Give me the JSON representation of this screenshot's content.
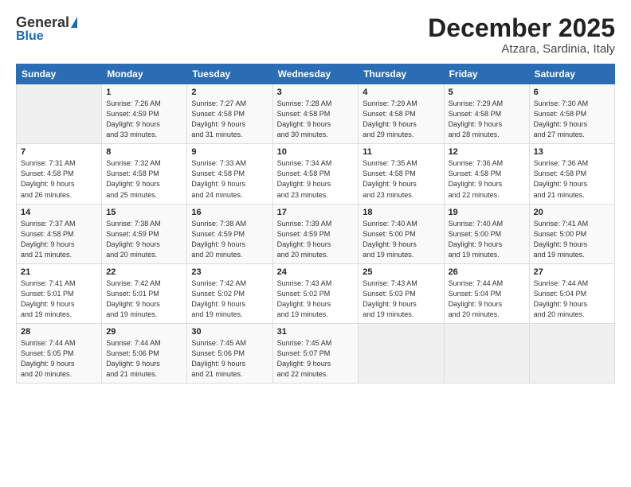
{
  "header": {
    "logo_general": "General",
    "logo_blue": "Blue",
    "month_title": "December 2025",
    "location": "Atzara, Sardinia, Italy"
  },
  "days_of_week": [
    "Sunday",
    "Monday",
    "Tuesday",
    "Wednesday",
    "Thursday",
    "Friday",
    "Saturday"
  ],
  "weeks": [
    [
      {
        "num": "",
        "info": ""
      },
      {
        "num": "1",
        "info": "Sunrise: 7:26 AM\nSunset: 4:59 PM\nDaylight: 9 hours\nand 33 minutes."
      },
      {
        "num": "2",
        "info": "Sunrise: 7:27 AM\nSunset: 4:58 PM\nDaylight: 9 hours\nand 31 minutes."
      },
      {
        "num": "3",
        "info": "Sunrise: 7:28 AM\nSunset: 4:58 PM\nDaylight: 9 hours\nand 30 minutes."
      },
      {
        "num": "4",
        "info": "Sunrise: 7:29 AM\nSunset: 4:58 PM\nDaylight: 9 hours\nand 29 minutes."
      },
      {
        "num": "5",
        "info": "Sunrise: 7:29 AM\nSunset: 4:58 PM\nDaylight: 9 hours\nand 28 minutes."
      },
      {
        "num": "6",
        "info": "Sunrise: 7:30 AM\nSunset: 4:58 PM\nDaylight: 9 hours\nand 27 minutes."
      }
    ],
    [
      {
        "num": "7",
        "info": "Sunrise: 7:31 AM\nSunset: 4:58 PM\nDaylight: 9 hours\nand 26 minutes."
      },
      {
        "num": "8",
        "info": "Sunrise: 7:32 AM\nSunset: 4:58 PM\nDaylight: 9 hours\nand 25 minutes."
      },
      {
        "num": "9",
        "info": "Sunrise: 7:33 AM\nSunset: 4:58 PM\nDaylight: 9 hours\nand 24 minutes."
      },
      {
        "num": "10",
        "info": "Sunrise: 7:34 AM\nSunset: 4:58 PM\nDaylight: 9 hours\nand 23 minutes."
      },
      {
        "num": "11",
        "info": "Sunrise: 7:35 AM\nSunset: 4:58 PM\nDaylight: 9 hours\nand 23 minutes."
      },
      {
        "num": "12",
        "info": "Sunrise: 7:36 AM\nSunset: 4:58 PM\nDaylight: 9 hours\nand 22 minutes."
      },
      {
        "num": "13",
        "info": "Sunrise: 7:36 AM\nSunset: 4:58 PM\nDaylight: 9 hours\nand 21 minutes."
      }
    ],
    [
      {
        "num": "14",
        "info": "Sunrise: 7:37 AM\nSunset: 4:58 PM\nDaylight: 9 hours\nand 21 minutes."
      },
      {
        "num": "15",
        "info": "Sunrise: 7:38 AM\nSunset: 4:59 PM\nDaylight: 9 hours\nand 20 minutes."
      },
      {
        "num": "16",
        "info": "Sunrise: 7:38 AM\nSunset: 4:59 PM\nDaylight: 9 hours\nand 20 minutes."
      },
      {
        "num": "17",
        "info": "Sunrise: 7:39 AM\nSunset: 4:59 PM\nDaylight: 9 hours\nand 20 minutes."
      },
      {
        "num": "18",
        "info": "Sunrise: 7:40 AM\nSunset: 5:00 PM\nDaylight: 9 hours\nand 19 minutes."
      },
      {
        "num": "19",
        "info": "Sunrise: 7:40 AM\nSunset: 5:00 PM\nDaylight: 9 hours\nand 19 minutes."
      },
      {
        "num": "20",
        "info": "Sunrise: 7:41 AM\nSunset: 5:00 PM\nDaylight: 9 hours\nand 19 minutes."
      }
    ],
    [
      {
        "num": "21",
        "info": "Sunrise: 7:41 AM\nSunset: 5:01 PM\nDaylight: 9 hours\nand 19 minutes."
      },
      {
        "num": "22",
        "info": "Sunrise: 7:42 AM\nSunset: 5:01 PM\nDaylight: 9 hours\nand 19 minutes."
      },
      {
        "num": "23",
        "info": "Sunrise: 7:42 AM\nSunset: 5:02 PM\nDaylight: 9 hours\nand 19 minutes."
      },
      {
        "num": "24",
        "info": "Sunrise: 7:43 AM\nSunset: 5:02 PM\nDaylight: 9 hours\nand 19 minutes."
      },
      {
        "num": "25",
        "info": "Sunrise: 7:43 AM\nSunset: 5:03 PM\nDaylight: 9 hours\nand 19 minutes."
      },
      {
        "num": "26",
        "info": "Sunrise: 7:44 AM\nSunset: 5:04 PM\nDaylight: 9 hours\nand 20 minutes."
      },
      {
        "num": "27",
        "info": "Sunrise: 7:44 AM\nSunset: 5:04 PM\nDaylight: 9 hours\nand 20 minutes."
      }
    ],
    [
      {
        "num": "28",
        "info": "Sunrise: 7:44 AM\nSunset: 5:05 PM\nDaylight: 9 hours\nand 20 minutes."
      },
      {
        "num": "29",
        "info": "Sunrise: 7:44 AM\nSunset: 5:06 PM\nDaylight: 9 hours\nand 21 minutes."
      },
      {
        "num": "30",
        "info": "Sunrise: 7:45 AM\nSunset: 5:06 PM\nDaylight: 9 hours\nand 21 minutes."
      },
      {
        "num": "31",
        "info": "Sunrise: 7:45 AM\nSunset: 5:07 PM\nDaylight: 9 hours\nand 22 minutes."
      },
      {
        "num": "",
        "info": ""
      },
      {
        "num": "",
        "info": ""
      },
      {
        "num": "",
        "info": ""
      }
    ]
  ]
}
